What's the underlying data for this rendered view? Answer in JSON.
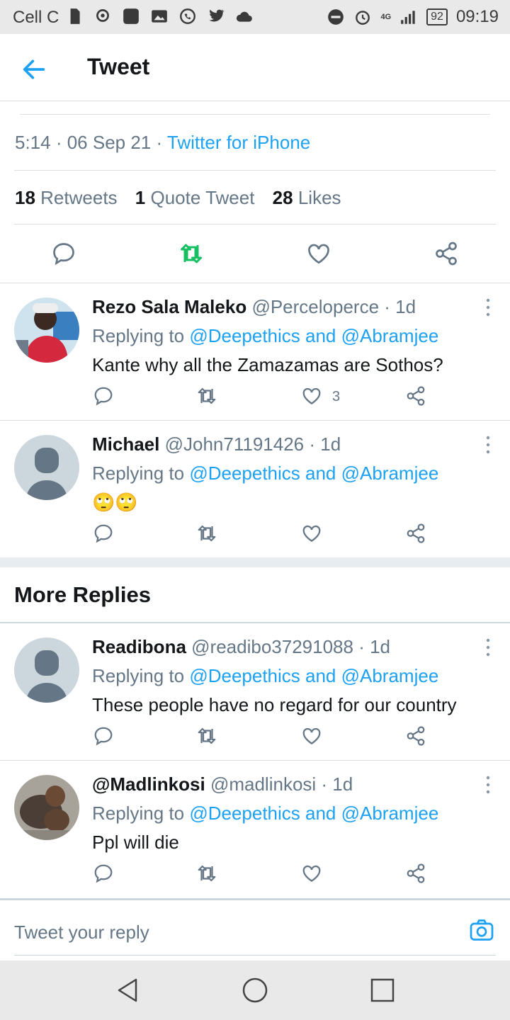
{
  "status_bar": {
    "carrier": "Cell C",
    "network": "4G",
    "battery": "92",
    "time": "09:19"
  },
  "header": {
    "title": "Tweet",
    "back_icon": "arrow-left-icon"
  },
  "tweet": {
    "time": "5:14",
    "date": "06 Sep 21",
    "source": "Twitter for iPhone",
    "retweets_count": "18",
    "retweets_label": "Retweets",
    "quotes_count": "1",
    "quotes_label": "Quote Tweet",
    "likes_count": "28",
    "likes_label": "Likes"
  },
  "replies": [
    {
      "name": "Rezo Sala Maleko",
      "handle": "@Perceloperce · 1d",
      "replying_prefix": "Replying to",
      "replying_to": "@Deepethics and @Abramjee",
      "text": "Kante why all the Zamazamas are Sothos?",
      "like_count": "3"
    },
    {
      "name": "Michael",
      "handle": "@John71191426 · 1d",
      "replying_prefix": "Replying to",
      "replying_to": "@Deepethics and @Abramjee",
      "text": "🙄🙄",
      "like_count": ""
    }
  ],
  "more_replies_title": "More Replies",
  "more_replies": [
    {
      "name": "Readibona",
      "handle": "@readibo37291088 · 1d",
      "replying_prefix": "Replying to",
      "replying_to": "@Deepethics and @Abramjee",
      "text": "These people have no regard for our country",
      "like_count": ""
    },
    {
      "name": "@Madlinkosi",
      "handle": "@madlinkosi · 1d",
      "replying_prefix": "Replying to",
      "replying_to": "@Deepethics and @Abramjee",
      "text": "Ppl will die",
      "like_count": ""
    }
  ],
  "reply_bar": {
    "placeholder": "Tweet your reply"
  },
  "colors": {
    "accent": "#1da1f2",
    "retweet_active": "#17bf63",
    "muted": "#657786"
  }
}
